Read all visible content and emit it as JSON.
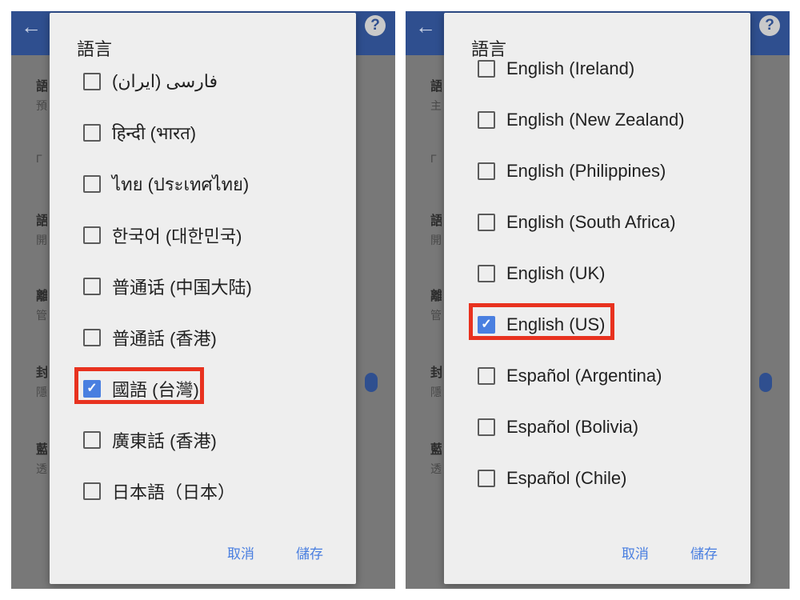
{
  "left": {
    "dialog_title": "語言",
    "background_items": [
      {
        "title": "語",
        "subtitle": "預"
      },
      {
        "title": "",
        "subtitle": "Γ"
      },
      {
        "title": "語",
        "subtitle": "開"
      },
      {
        "title": "離",
        "subtitle": "管"
      },
      {
        "title": "封",
        "subtitle": "隱"
      },
      {
        "title": "藍",
        "subtitle": "透"
      }
    ],
    "options": [
      {
        "label": "فارسی (ایران)",
        "checked": false
      },
      {
        "label": "हिन्दी (भारत)",
        "checked": false
      },
      {
        "label": "ไทย (ประเทศไทย)",
        "checked": false
      },
      {
        "label": "한국어 (대한민국)",
        "checked": false
      },
      {
        "label": "普通话 (中国大陆)",
        "checked": false
      },
      {
        "label": "普通話 (香港)",
        "checked": false
      },
      {
        "label": "國語 (台灣)",
        "checked": true
      },
      {
        "label": "廣東話 (香港)",
        "checked": false
      },
      {
        "label": "日本語（日本）",
        "checked": false
      }
    ],
    "cancel_label": "取消",
    "save_label": "儲存"
  },
  "right": {
    "dialog_title": "語言",
    "background_items": [
      {
        "title": "語",
        "subtitle": "主"
      },
      {
        "title": "",
        "subtitle": "Γ"
      },
      {
        "title": "語",
        "subtitle": "開"
      },
      {
        "title": "離",
        "subtitle": "管"
      },
      {
        "title": "封",
        "subtitle": "隱"
      },
      {
        "title": "藍",
        "subtitle": "透"
      }
    ],
    "options": [
      {
        "label": "English (Ireland)",
        "checked": false
      },
      {
        "label": "English (New Zealand)",
        "checked": false
      },
      {
        "label": "English (Philippines)",
        "checked": false
      },
      {
        "label": "English (South Africa)",
        "checked": false
      },
      {
        "label": "English (UK)",
        "checked": false
      },
      {
        "label": "English (US)",
        "checked": true
      },
      {
        "label": "Español (Argentina)",
        "checked": false
      },
      {
        "label": "Español (Bolivia)",
        "checked": false
      },
      {
        "label": "Español (Chile)",
        "checked": false
      }
    ],
    "cancel_label": "取消",
    "save_label": "儲存"
  },
  "icons": {
    "back": "arrow-left-icon",
    "help": "help-circle-icon",
    "check": "checkmark-icon"
  },
  "colors": {
    "app_bar": "#2f4f8f",
    "checkbox_checked": "#4a7fe0",
    "highlight": "#e8321f",
    "action_text": "#4a7fe0"
  }
}
